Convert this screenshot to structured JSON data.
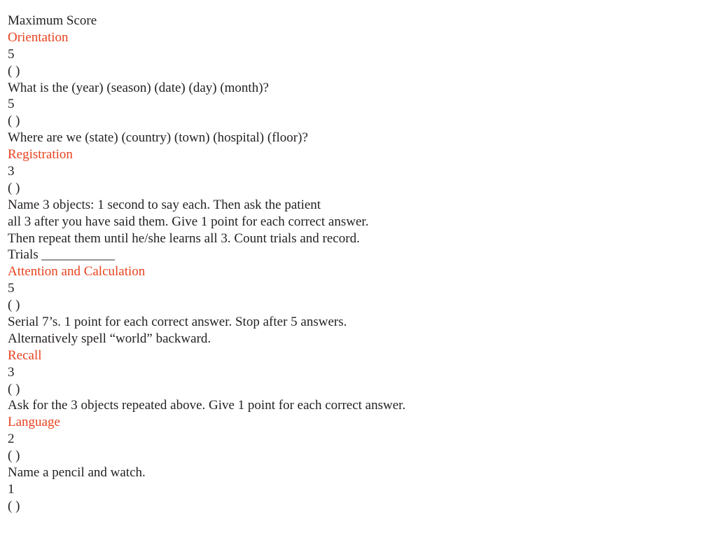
{
  "document": {
    "header": "Maximum Score",
    "accent_color": "#e8431f",
    "sections": [
      {
        "title": "Orientation",
        "items": [
          {
            "max_score": "5",
            "score": "( )",
            "text_lines": [
              "What is the (year) (season) (date) (day) (month)?"
            ]
          },
          {
            "max_score": "5",
            "score": "( )",
            "text_lines": [
              "Where are we (state) (country) (town) (hospital) (floor)?"
            ]
          }
        ]
      },
      {
        "title": "Registration",
        "items": [
          {
            "max_score": "3",
            "score": "( )",
            "text_lines": [
              "Name 3 objects: 1 second to say each. Then ask the patient",
              "all 3 after you have said them. Give 1 point for each correct answer.",
              "Then repeat them until he/she learns all 3. Count trials and record.",
              "Trials ___________"
            ]
          }
        ]
      },
      {
        "title": "Attention and Calculation",
        "items": [
          {
            "max_score": "5",
            "score": "( )",
            "text_lines": [
              "Serial 7’s. 1 point for each correct answer. Stop after 5 answers.",
              "Alternatively spell “world” backward."
            ]
          }
        ]
      },
      {
        "title": "Recall",
        "items": [
          {
            "max_score": "3",
            "score": "( )",
            "text_lines": [
              "Ask for the 3 objects repeated above. Give 1 point for each correct answer."
            ]
          }
        ]
      },
      {
        "title": "Language",
        "items": [
          {
            "max_score": "2",
            "score": "( )",
            "text_lines": [
              "Name a pencil and watch."
            ]
          },
          {
            "max_score": "1",
            "score": "( )",
            "text_lines": []
          }
        ]
      }
    ]
  }
}
